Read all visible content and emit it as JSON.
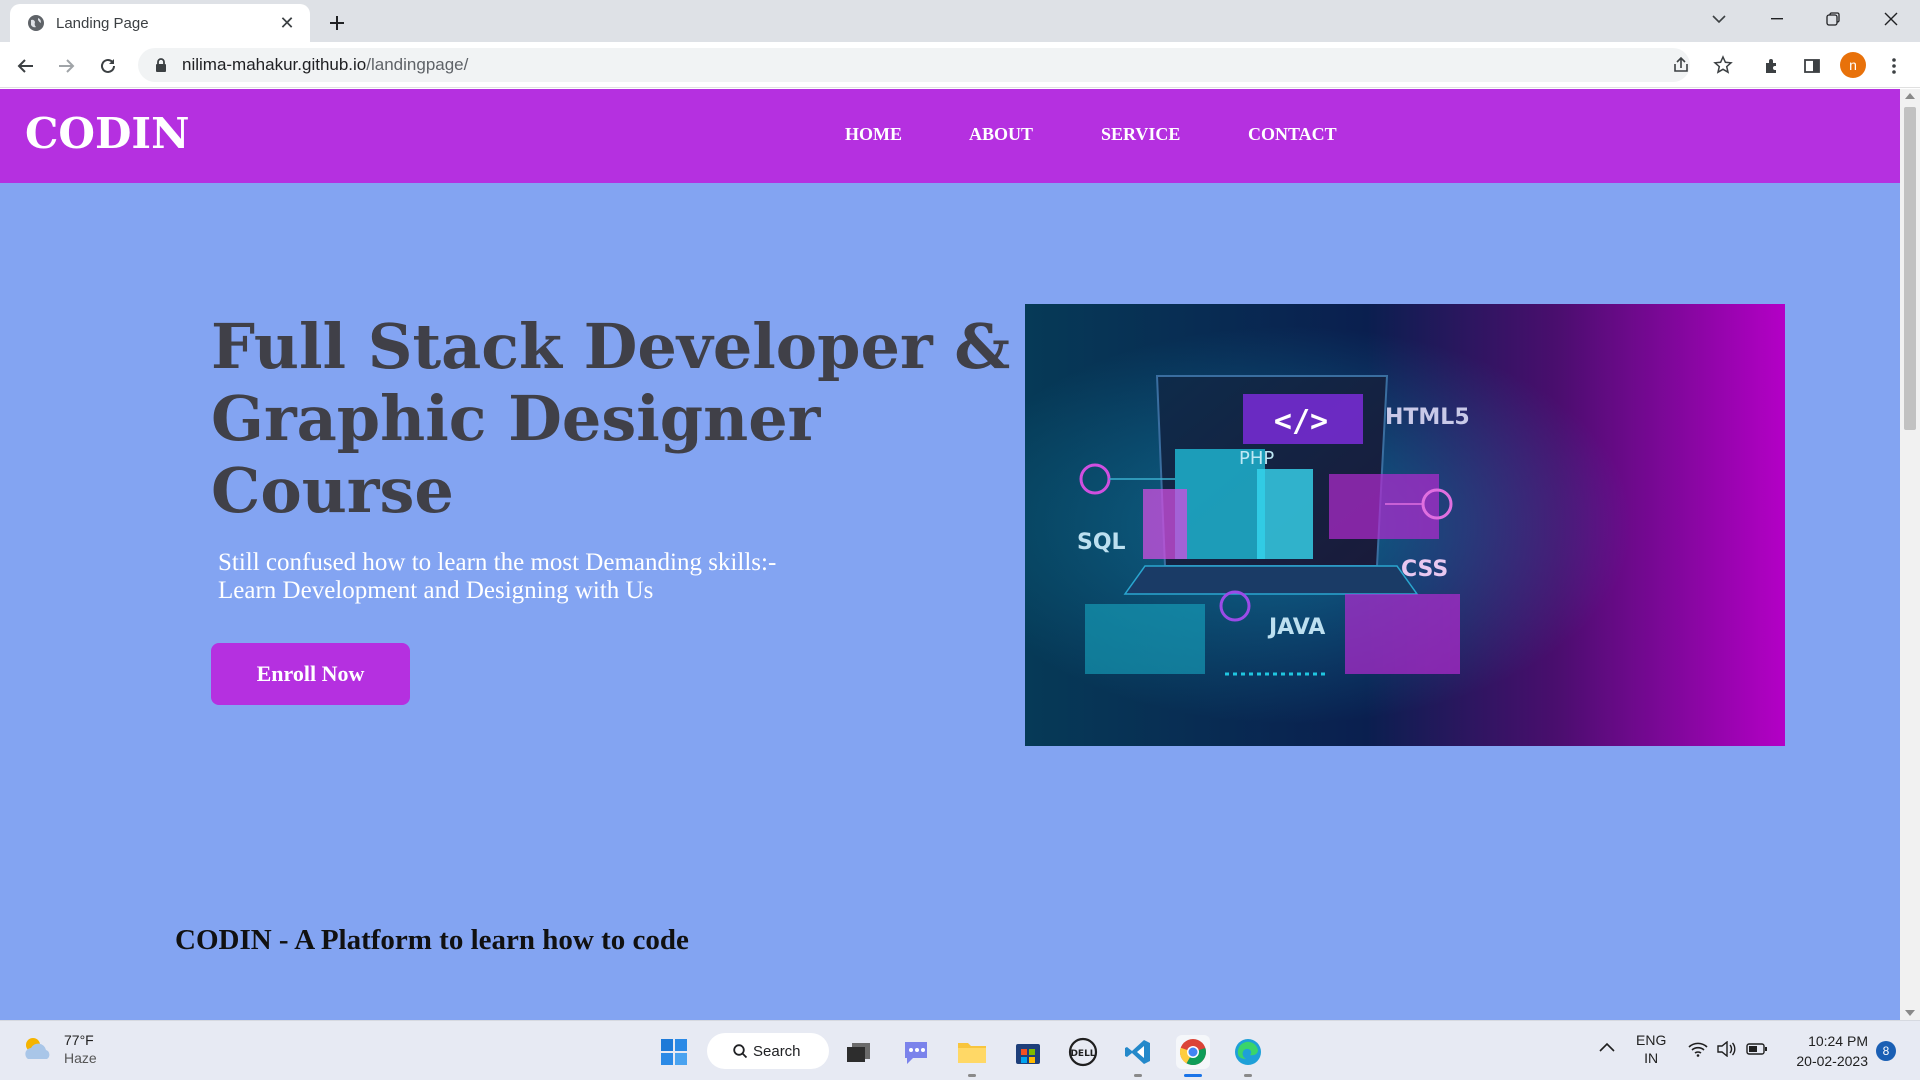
{
  "browser": {
    "tab_title": "Landing Page",
    "url_host": "nilima-mahakur.github.io",
    "url_path": "/landingpage/",
    "profile_initial": "n"
  },
  "site": {
    "logo": "CODIN",
    "nav": [
      "HOME",
      "ABOUT",
      "SERVICE",
      "CONTACT"
    ],
    "hero": {
      "title": "Full Stack Developer & Graphic Designer Course",
      "subtitle_line1": "Still confused how to learn the most Demanding skills:-",
      "subtitle_line2": "Learn Development and Designing with Us",
      "cta": "Enroll Now",
      "image_labels": {
        "code": "</>",
        "html": "HTML5",
        "php": "PHP",
        "sql": "SQL",
        "css": "CSS",
        "java": "JAVA"
      }
    },
    "tagline": "CODIN - A Platform to learn how to code",
    "colors": {
      "header": "#b530e0",
      "background": "#83a4f2",
      "title": "#404048"
    }
  },
  "taskbar": {
    "weather_temp": "77°F",
    "weather_cond": "Haze",
    "search_label": "Search",
    "lang_line1": "ENG",
    "lang_line2": "IN",
    "time": "10:24 PM",
    "date": "20-02-2023",
    "notification_count": "8",
    "apps": [
      "windows-start",
      "search",
      "task-view",
      "teams-chat",
      "file-explorer",
      "microsoft-store",
      "dell",
      "vscode",
      "chrome",
      "edge"
    ]
  }
}
